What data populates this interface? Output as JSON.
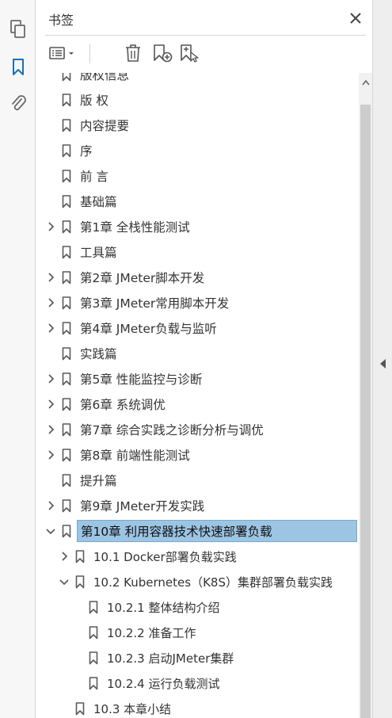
{
  "panel": {
    "title": "书签"
  },
  "rail": {
    "icons": [
      "pages-icon",
      "bookmark-icon",
      "attachment-icon"
    ]
  },
  "toolbar": {
    "icons": [
      "options-menu-icon",
      "delete-icon",
      "new-bookmark-icon",
      "bookmark-from-selection-icon"
    ]
  },
  "colors": {
    "selected_bg": "#9cc5e4",
    "accent": "#1a6fb5",
    "icon_gray": "#6a6a6a"
  },
  "bookmarks": [
    {
      "label": "版权信息",
      "level": 0,
      "expander": "none",
      "partial": true
    },
    {
      "label": "版 权",
      "level": 0,
      "expander": "none"
    },
    {
      "label": "内容提要",
      "level": 0,
      "expander": "none"
    },
    {
      "label": "序",
      "level": 0,
      "expander": "none"
    },
    {
      "label": "前 言",
      "level": 0,
      "expander": "none"
    },
    {
      "label": "基础篇",
      "level": 0,
      "expander": "none"
    },
    {
      "label": "第1章 全栈性能测试",
      "level": 0,
      "expander": "collapsed"
    },
    {
      "label": "工具篇",
      "level": 0,
      "expander": "none"
    },
    {
      "label": "第2章 JMeter脚本开发",
      "level": 0,
      "expander": "collapsed"
    },
    {
      "label": "第3章 JMeter常用脚本开发",
      "level": 0,
      "expander": "collapsed"
    },
    {
      "label": "第4章 JMeter负载与监听",
      "level": 0,
      "expander": "collapsed"
    },
    {
      "label": "实践篇",
      "level": 0,
      "expander": "none"
    },
    {
      "label": "第5章 性能监控与诊断",
      "level": 0,
      "expander": "collapsed"
    },
    {
      "label": "第6章 系统调优",
      "level": 0,
      "expander": "collapsed"
    },
    {
      "label": "第7章 综合实践之诊断分析与调优",
      "level": 0,
      "expander": "collapsed"
    },
    {
      "label": "第8章 前端性能测试",
      "level": 0,
      "expander": "collapsed"
    },
    {
      "label": "提升篇",
      "level": 0,
      "expander": "none"
    },
    {
      "label": "第9章 JMeter开发实践",
      "level": 0,
      "expander": "collapsed"
    },
    {
      "label": "第10章 利用容器技术快速部署负载",
      "level": 0,
      "expander": "expanded",
      "selected": true
    },
    {
      "label": "10.1 Docker部署负载实践",
      "level": 1,
      "expander": "collapsed"
    },
    {
      "label": "10.2 Kubernetes（K8S）集群部署负载实践",
      "level": 1,
      "expander": "expanded"
    },
    {
      "label": "10.2.1 整体结构介绍",
      "level": 2,
      "expander": "none"
    },
    {
      "label": "10.2.2 准备工作",
      "level": 2,
      "expander": "none"
    },
    {
      "label": "10.2.3 启动JMeter集群",
      "level": 2,
      "expander": "none"
    },
    {
      "label": "10.2.4 运行负载测试",
      "level": 2,
      "expander": "none"
    },
    {
      "label": "10.3 本章小结",
      "level": 1,
      "expander": "none"
    }
  ]
}
